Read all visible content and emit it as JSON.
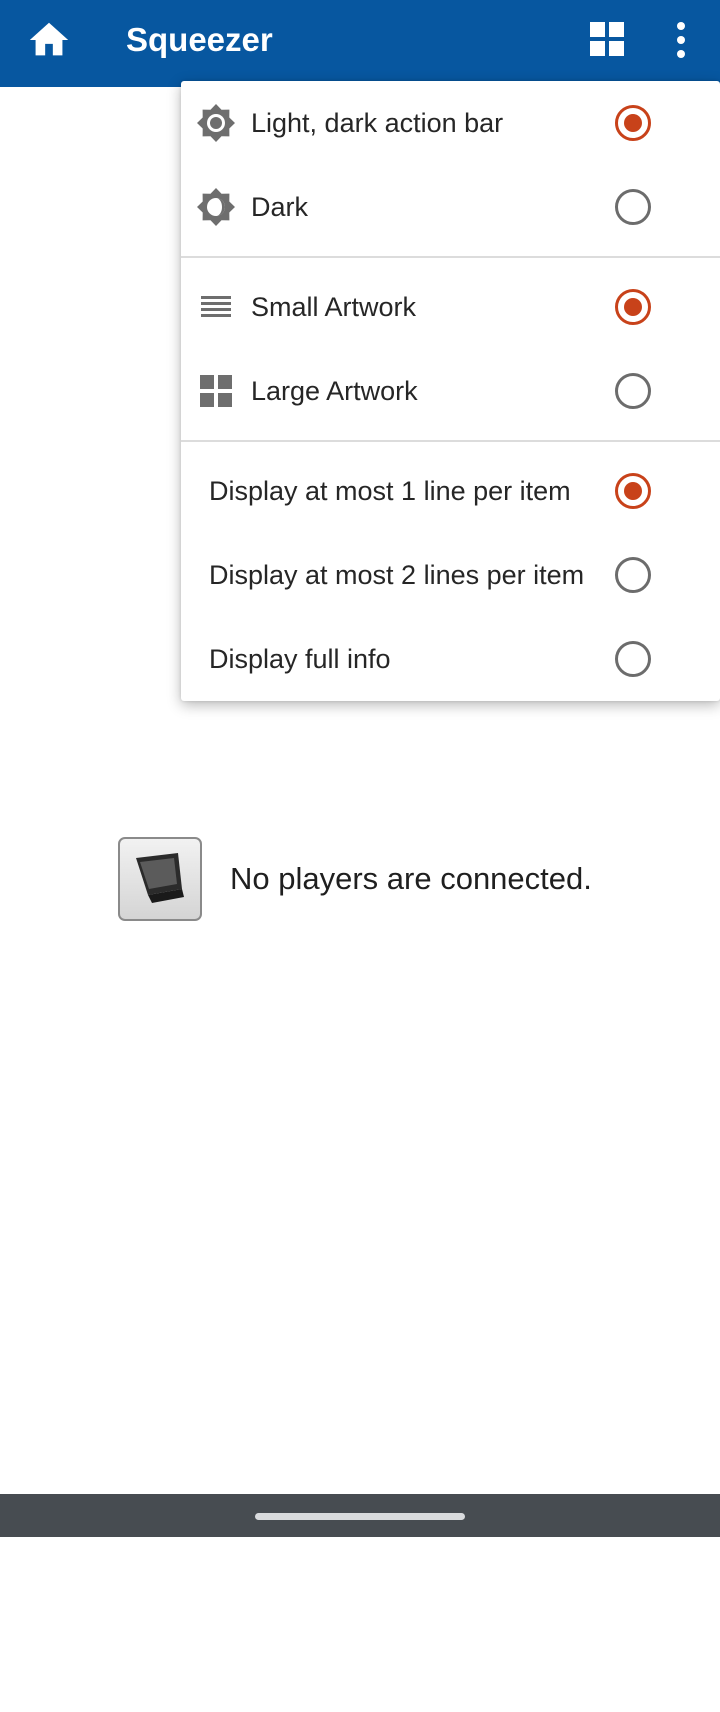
{
  "app_bar": {
    "title": "Squeezer",
    "home_icon": "home-icon",
    "view_toggle_icon": "grid-icon",
    "overflow_icon": "more-vert-icon",
    "color": "#0757a0"
  },
  "menu": {
    "theme_items": [
      {
        "label": "Light, dark action bar",
        "icon": "brightness-icon",
        "checked": true
      },
      {
        "label": "Dark",
        "icon": "dark-mode-icon",
        "checked": false
      }
    ],
    "artwork_items": [
      {
        "label": "Small Artwork",
        "icon": "list-icon",
        "checked": true
      },
      {
        "label": "Large Artwork",
        "icon": "grid-icon",
        "checked": false
      }
    ],
    "display_items": [
      {
        "label": "Display at most 1 line per item",
        "checked": true
      },
      {
        "label": "Display at most 2 lines per item",
        "checked": false
      },
      {
        "label": "Display full info",
        "checked": false
      }
    ],
    "accent_color": "#c8421a"
  },
  "main": {
    "empty_message": "No players are connected.",
    "empty_icon": "player-device-icon"
  }
}
